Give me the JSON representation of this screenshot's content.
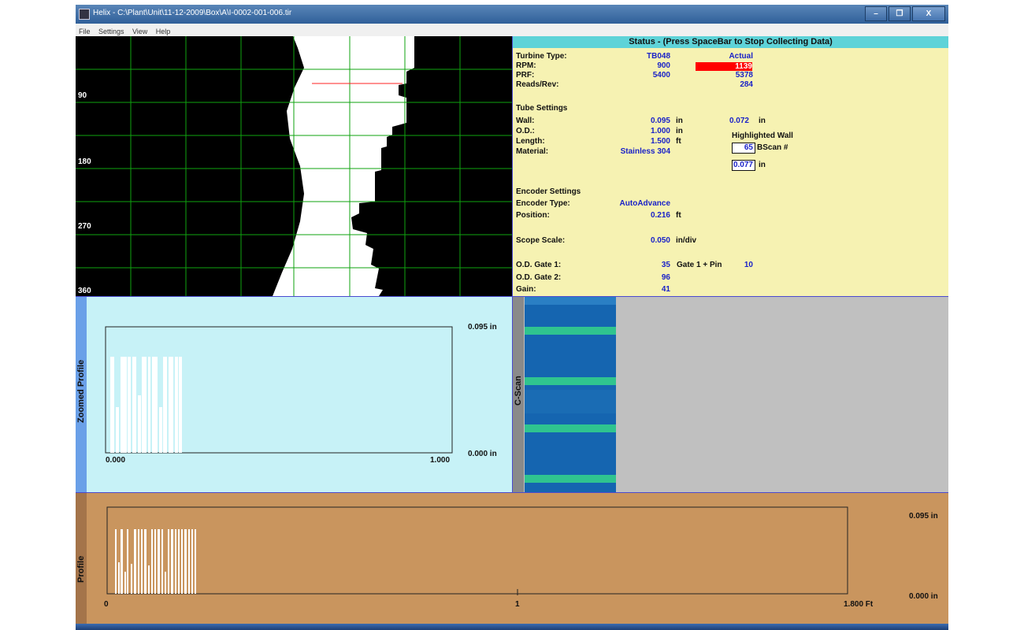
{
  "window": {
    "title": "Helix - C:\\Plant\\Unit\\11-12-2009\\Box\\A\\I-0002-001-006.tir",
    "controls": [
      "–",
      "❐",
      "X"
    ]
  },
  "menu": [
    "File",
    "Settings",
    "View",
    "Help"
  ],
  "bscan": {
    "angle_labels": [
      "90",
      "180",
      "270",
      "360"
    ]
  },
  "status": {
    "header": "Status -  (Press SpaceBar to Stop Collecting Data)",
    "turbine_type_label": "Turbine Type:",
    "turbine_type_value": "TB048",
    "actual_label": "Actual",
    "rpm_label": "RPM:",
    "rpm_value": "900",
    "rpm_actual": "1139",
    "prf_label": "PRF:",
    "prf_value": "5400",
    "prf_actual": "5378",
    "reads_label": "Reads/Rev:",
    "reads_actual": "284",
    "tube_settings_label": "Tube Settings",
    "wall_label": "Wall:",
    "wall_value": "0.095",
    "wall_unit": "in",
    "wall_actual": "0.072",
    "wall_actual_unit": "in",
    "od_label": "O.D.:",
    "od_value": "1.000",
    "od_unit": "in",
    "highlighted_wall_label": "Highlighted Wall",
    "length_label": "Length:",
    "length_value": "1.500",
    "length_unit": "ft",
    "bscan_num": "65",
    "bscan_label": "BScan #",
    "material_label": "Material:",
    "material_value": "Stainless 304",
    "hw_value": "0.077",
    "hw_unit": "in",
    "encoder_settings_label": "Encoder Settings",
    "encoder_type_label": "Encoder Type:",
    "encoder_type_value": "AutoAdvance",
    "position_label": "Position:",
    "position_value": "0.216",
    "position_unit": "ft",
    "scope_scale_label": "Scope Scale:",
    "scope_scale_value": "0.050",
    "scope_scale_unit": "in/div",
    "od_gate1_label": "O.D. Gate 1:",
    "od_gate1_value": "35",
    "gate_pin_label": "Gate 1 + Pin",
    "gate_pin_value": "10",
    "od_gate2_label": "O.D. Gate 2:",
    "od_gate2_value": "96",
    "gain_label": "Gain:",
    "gain_value": "41"
  },
  "zoomed": {
    "side_label": "Zoomed  Profile",
    "y_top": "0.095 in",
    "y_bottom": "0.000 in",
    "x_left": "0.000",
    "x_right": "1.000"
  },
  "cscan": {
    "side_label": "C-Scan"
  },
  "profile": {
    "side_label": "Profile",
    "y_top": "0.095 in",
    "y_bottom": "0.000 in",
    "x_left": "0",
    "x_mid": "1",
    "x_right": "1.800 Ft"
  },
  "colors": {
    "status_bg": "#f6f2b2",
    "status_header": "#5ed3d8",
    "rpm_alert": "#ff0000",
    "zoomed_bg": "#c7f2f7",
    "profile_bg": "#c9955e",
    "cscan_blue": "#1565b0",
    "cscan_band": "#2fc48f"
  }
}
